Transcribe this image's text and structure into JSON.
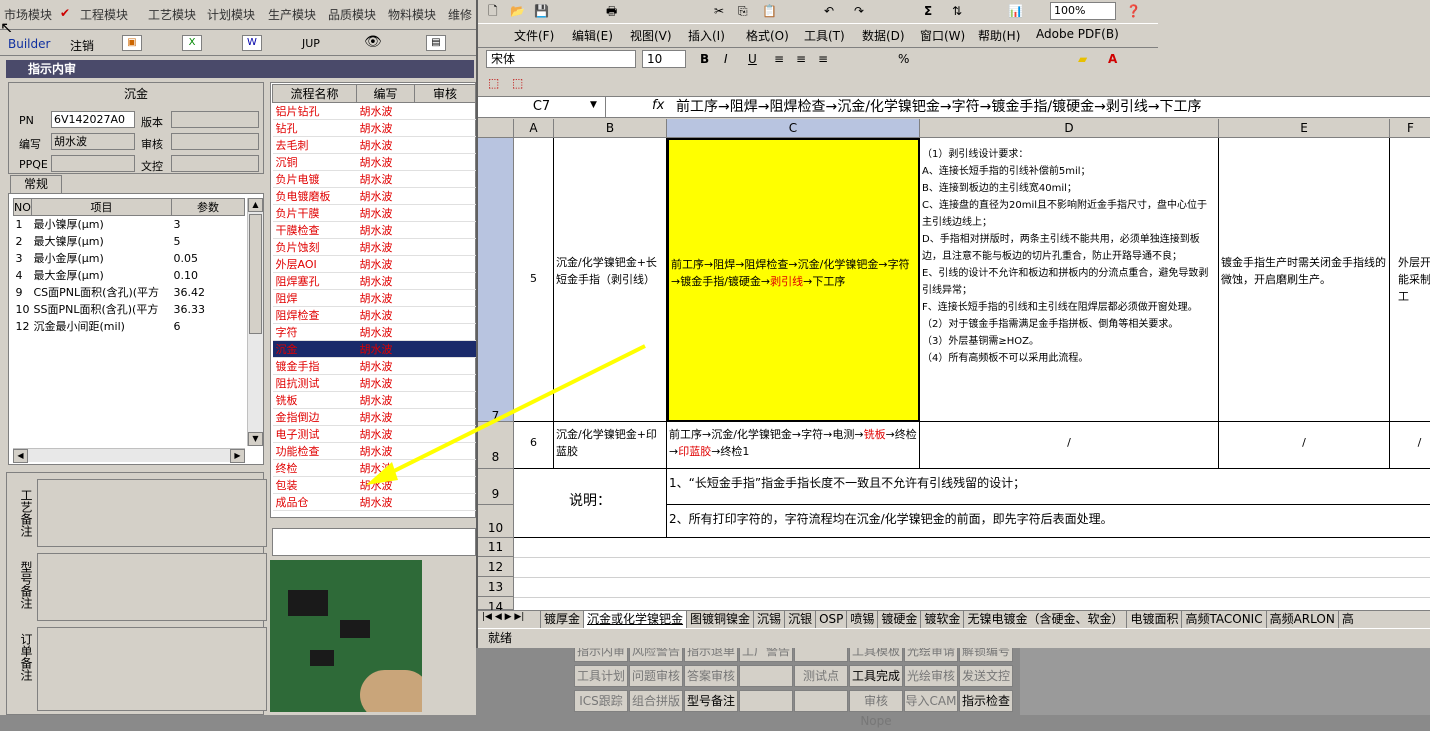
{
  "bg_app": {
    "top_menu": [
      "市场模块",
      "工程模块",
      "工艺模块",
      "计划模块",
      "生产模块",
      "品质模块",
      "物料模块",
      "维修"
    ],
    "builder_bar": {
      "builder": "Builder",
      "logout": "注销",
      "jup": "JUP"
    },
    "panel_title": "指示内审",
    "group_title": "沉金",
    "fields": {
      "pn_label": "PN",
      "pn_value": "6V142027A0",
      "version_label": "版本",
      "version_value": "",
      "author_label": "编写",
      "author_value": "胡水波",
      "review_label": "审核",
      "review_value": "",
      "ppqe_label": "PPQE",
      "ppqe_value": "",
      "doc_label": "文控",
      "doc_value": ""
    },
    "tab_general": "常规",
    "params_headers": [
      "NO",
      "项目",
      "参数"
    ],
    "params_rows": [
      {
        "no": "1",
        "item": "最小镍厚(μm)",
        "value": "3"
      },
      {
        "no": "2",
        "item": "最大镍厚(μm)",
        "value": "5"
      },
      {
        "no": "3",
        "item": "最小金厚(μm)",
        "value": "0.05"
      },
      {
        "no": "4",
        "item": "最大金厚(μm)",
        "value": "0.10"
      },
      {
        "no": "9",
        "item": "CS面PNL面积(含孔)(平方",
        "value": "36.42"
      },
      {
        "no": "10",
        "item": "SS面PNL面积(含孔)(平方",
        "value": "36.33"
      },
      {
        "no": "12",
        "item": "沉金最小间距(mil)",
        "value": "6"
      }
    ],
    "proc_headers": [
      "流程名称",
      "编写",
      "审核"
    ],
    "proc_rows": [
      {
        "name": "铝片钻孔",
        "author": "胡水波"
      },
      {
        "name": "钻孔",
        "author": "胡水波"
      },
      {
        "name": "去毛刺",
        "author": "胡水波"
      },
      {
        "name": "沉铜",
        "author": "胡水波"
      },
      {
        "name": "负片电镀",
        "author": "胡水波"
      },
      {
        "name": "负电镀磨板",
        "author": "胡水波"
      },
      {
        "name": "负片干膜",
        "author": "胡水波"
      },
      {
        "name": "干膜检查",
        "author": "胡水波"
      },
      {
        "name": "负片蚀刻",
        "author": "胡水波"
      },
      {
        "name": "外层AOI",
        "author": "胡水波"
      },
      {
        "name": "阻焊塞孔",
        "author": "胡水波"
      },
      {
        "name": "阻焊",
        "author": "胡水波"
      },
      {
        "name": "阻焊检查",
        "author": "胡水波"
      },
      {
        "name": "字符",
        "author": "胡水波"
      },
      {
        "name": "沉金",
        "author": "胡水波"
      },
      {
        "name": "镀金手指",
        "author": "胡水波"
      },
      {
        "name": "阻抗测试",
        "author": "胡水波"
      },
      {
        "name": "铣板",
        "author": "胡水波"
      },
      {
        "name": "金指倒边",
        "author": "胡水波"
      },
      {
        "name": "电子测试",
        "author": "胡水波"
      },
      {
        "name": "功能检查",
        "author": "胡水波"
      },
      {
        "name": "终检",
        "author": "胡水波"
      },
      {
        "name": "包装",
        "author": "胡水波"
      },
      {
        "name": "成品仓",
        "author": "胡水波"
      }
    ],
    "memo_labels": [
      "工艺备注",
      "型号备注",
      "订单备注"
    ],
    "bottom_buttons": [
      [
        "指示内审",
        "风险警告",
        "指示退单",
        "工厂警告",
        "",
        "工具模板",
        "光绘审请",
        "解锁编号"
      ],
      [
        "工具计划",
        "问题审核",
        "答案审核",
        "",
        "测试点",
        "工具完成",
        "光绘审核",
        "发送文控"
      ],
      [
        "ICS跟踪",
        "组合拼版",
        "型号备注",
        "",
        "",
        "审核Nope",
        "导入CAM",
        "指示检查"
      ]
    ]
  },
  "excel": {
    "menu": [
      "文件(F)",
      "编辑(E)",
      "视图(V)",
      "插入(I)",
      "格式(O)",
      "工具(T)",
      "数据(D)",
      "窗口(W)",
      "帮助(H)",
      "Adobe PDF(B)"
    ],
    "font_name": "宋体",
    "font_size": "10",
    "zoom": "100%",
    "name_box": "C7",
    "formula": "前工序→阻焊→阻焊检查→沉金/化学镍钯金→字符→镀金手指/镀硬金→剥引线→下工序",
    "columns": [
      "A",
      "B",
      "C",
      "D",
      "E",
      "F"
    ],
    "rows": [
      "7",
      "8",
      "9",
      "10",
      "11",
      "12",
      "13",
      "14"
    ],
    "r7": {
      "a": "5",
      "b": "沉金/化学镍钯金+长短金手指（剥引线）",
      "c_part1": "前工序→阻焊→阻焊检查→沉金/化学镍钯金→字符→镀金手指/镀硬金→",
      "c_red": "剥引线",
      "c_part2": "→下工序",
      "d": [
        "（1）剥引线设计要求：",
        "A、连接长短手指的引线补偿前5mil；",
        "B、连接到板边的主引线宽40mil；",
        "C、连接盘的直径为20mil且不影响附近金手指尺寸，盘中心位于主引线边线上；",
        "D、手指相对拼版时，两条主引线不能共用，必须单独连接到板边，且注意不能与板边的切片孔重合，防止开路导通不良；",
        "E、引线的设计不允许和板边和拼板内的分流点重合，避免导致剥引线异常；",
        "F、连接长短手指的引线和主引线在阻焊层都必须做开窗处理。",
        "（2）对于镀金手指需满足金手指拼板、倒角等相关要求。",
        "（3）外层基铜需≥HOZ。",
        "（4）所有高频板不可以采用此流程。"
      ],
      "e": "镀金手指生产时需关闭金手指线的微蚀，开启磨刷生产。",
      "f": "外层开不能采制作工"
    },
    "r8": {
      "a": "6",
      "b": "沉金/化学镍钯金+印蓝胶",
      "c_part1": "前工序→沉金/化学镍钯金→字符→电测→",
      "c_red1": "铣板",
      "c_mid": "→终检→",
      "c_red2": "印蓝胶",
      "c_part2": "→终检1",
      "d": "/",
      "e": "/",
      "f": "/"
    },
    "note_label": "说明：",
    "note1": "1、“长短金手指”指金手指长度不一致且不允许有引线残留的设计；",
    "note2": "2、所有打印字符的，字符流程均在沉金/化学镍钯金的前面，即先字符后表面处理。",
    "sheet_tabs": [
      "镀厚金",
      "沉金或化学镍钯金",
      "图镀铜镍金",
      "沉锡",
      "沉银",
      "OSP",
      "喷锡",
      "镀硬金",
      "镀软金",
      "无镍电镀金（含硬金、软金）",
      "电镀面积",
      "高频TACONIC",
      "高频ARLON",
      "高"
    ],
    "status": "就绪"
  },
  "colors": {
    "selection_yellow": "#ffff00",
    "process_red": "#e00000",
    "arrow": "#ffff00",
    "selected_row": "#1a2a6a"
  }
}
